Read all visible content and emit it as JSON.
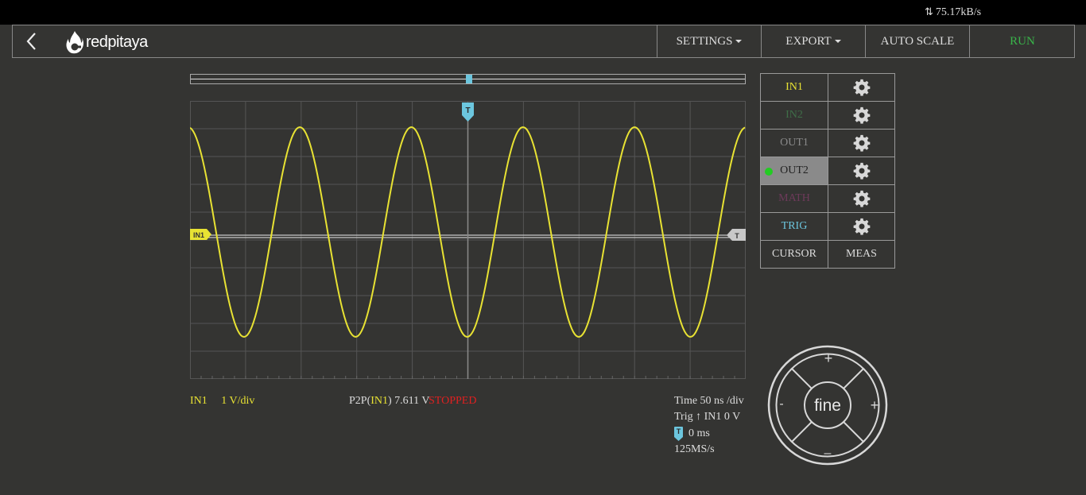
{
  "status_bar": {
    "transfer_rate": "75.17kB/s"
  },
  "nav": {
    "logo_text": "redpitaya",
    "settings": "SETTINGS",
    "export": "EXPORT",
    "auto_scale": "AUTO SCALE",
    "run": "RUN"
  },
  "colors": {
    "in1": "#e8e233",
    "in2": "#3f6e48",
    "out1": "#8a8a8a",
    "math": "#6d3a5a",
    "trig": "#6cc6de",
    "run": "#39b54a",
    "stopped": "#e02020"
  },
  "plot": {
    "channel_marker": "IN1",
    "trigger_marker": "T",
    "trigger_level_marker": "T"
  },
  "chart_data": {
    "type": "line",
    "series": [
      {
        "name": "IN1",
        "waveform": "sine",
        "cycles_visible": 5,
        "amplitude_divs": 3.8
      }
    ],
    "grid_divisions": {
      "x": 10,
      "y": 10
    }
  },
  "channels": [
    {
      "label": "IN1"
    },
    {
      "label": "IN2"
    },
    {
      "label": "OUT1"
    },
    {
      "label": "OUT2"
    },
    {
      "label": "MATH"
    },
    {
      "label": "TRIG"
    }
  ],
  "tools": {
    "cursor": "CURSOR",
    "meas": "MEAS"
  },
  "readout": {
    "channel": "IN1",
    "scale": "1 V/div",
    "p2p_prefix": "P2P(",
    "p2p_channel": "IN1",
    "p2p_value": ") 7.611 V",
    "state": "STOPPED",
    "time": "Time  50  ns /div",
    "trig": "Trig",
    "trig_detail": "IN1  0  V",
    "trig_icon": "T",
    "offset": "0 ms",
    "sample_rate": "125MS/s"
  },
  "joystick": {
    "center": "fine",
    "up": "+",
    "down": "–",
    "left": "-",
    "right": "+"
  }
}
